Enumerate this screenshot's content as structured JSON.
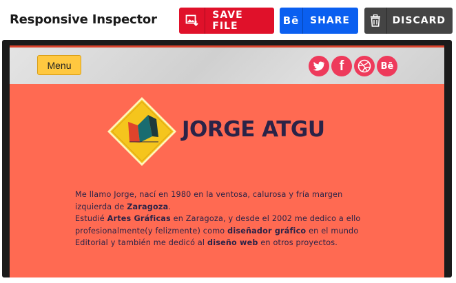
{
  "app": {
    "title": "Responsive Inspector"
  },
  "toolbar": {
    "save": {
      "label": "SAVE FILE",
      "icon": "save-image-icon",
      "color": "#e0112a"
    },
    "share": {
      "label": "SHARE",
      "icon": "behance-icon",
      "icon_text": "Bē",
      "color": "#0a5ff0"
    },
    "discard": {
      "label": "DISCARD",
      "icon": "trash-icon",
      "color": "#444444"
    }
  },
  "preview": {
    "background_color": "#ff6a52",
    "nav": {
      "menu_label": "Menu",
      "social": [
        {
          "name": "twitter-icon",
          "glyph": "t"
        },
        {
          "name": "facebook-icon",
          "glyph": "f"
        },
        {
          "name": "dribbble-icon",
          "glyph": ""
        },
        {
          "name": "behance-icon",
          "glyph": "Bē"
        }
      ],
      "social_color": "#ee3a5b"
    },
    "brand": "JORGE ATGU",
    "bio": {
      "l1a": "Me llamo Jorge, nací en 1980 en la ventosa, calurosa y fría margen izquierda de ",
      "l1b": "Zaragoza",
      "l1c": ".",
      "l2a": "Estudié ",
      "l2b": "Artes Gráficas",
      "l2c": " en Zaragoza, y desde el 2002 me dedico a ello profesionalmente(y felizmente) como ",
      "l2d": "diseñador gráfico",
      "l2e": " en el mundo Editorial y también me dedicó al ",
      "l2f": "diseño web",
      "l2g": " en otros proyectos."
    }
  }
}
